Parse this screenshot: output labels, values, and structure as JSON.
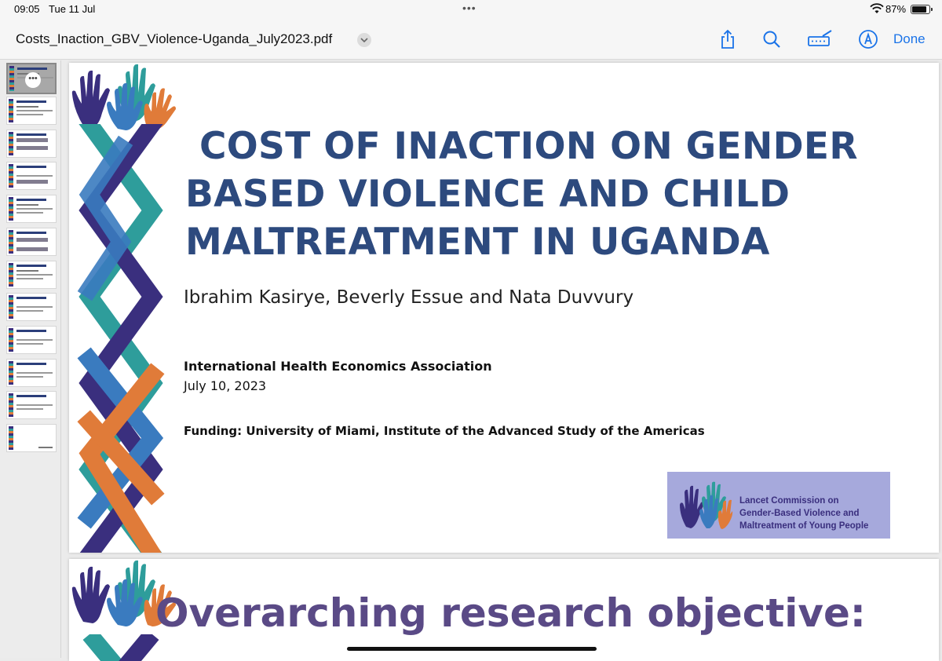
{
  "status": {
    "time": "09:05",
    "date": "Tue 11 Jul",
    "battery": "87%",
    "battery_level": 0.87,
    "multitask_dots": "•••"
  },
  "nav": {
    "document_title": "Costs_Inaction_GBV_Violence-Uganda_July2023.pdf",
    "done_label": "Done",
    "icons": [
      "share-icon",
      "search-icon",
      "markup-icon",
      "pencil-circle-icon"
    ]
  },
  "sidebar": {
    "thumbnail_count": 12,
    "active_index": 0,
    "thumbnail_options_glyph": "•••"
  },
  "slide1": {
    "title_lines": [
      "COST OF INACTION ON GENDER",
      "BASED VIOLENCE AND CHILD",
      "MALTREATMENT IN UGANDA"
    ],
    "authors": "Ibrahim Kasirye, Beverly Essue and Nata Duvvury",
    "organization": "International Health Economics Association",
    "date": "July 10, 2023",
    "funding": "Funding: University of Miami, Institute of the Advanced Study of the Americas",
    "logo_lines": [
      "Lancet Commission on",
      "Gender-Based Violence and",
      "Maltreatment of Young People"
    ]
  },
  "slide2": {
    "title": "Overarching research objective:"
  },
  "colors": {
    "title_blue": "#2d4a7e",
    "purple": "#3a2f7e",
    "teal": "#2e9d9b",
    "orange": "#e07b39",
    "blue": "#3a7bbf",
    "lancet_bg": "#a6a9dc",
    "link_blue": "#1a73e8"
  }
}
